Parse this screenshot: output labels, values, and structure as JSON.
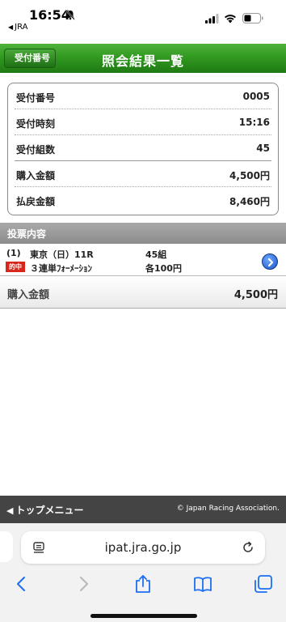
{
  "status_bar": {
    "time": "16:54",
    "back_app": "JRA"
  },
  "header": {
    "back_label": "受付番号",
    "title": "照会結果一覧"
  },
  "summary": {
    "rows": [
      {
        "label": "受付番号",
        "value": "0005"
      },
      {
        "label": "受付時刻",
        "value": "15:16"
      },
      {
        "label": "受付組数",
        "value": "45"
      },
      {
        "label": "購入金額",
        "value": "4,500円"
      },
      {
        "label": "払戻金額",
        "value": "8,460円"
      }
    ]
  },
  "section": {
    "title": "投票内容"
  },
  "bet": {
    "number": "(1)",
    "race": "東京（日）11R",
    "hit_badge": "的中",
    "type": "３連単ﾌｫｰﾒｰｼｮﾝ",
    "count": "45組",
    "unit": "各100円"
  },
  "total": {
    "label": "購入金額",
    "value": "4,500円"
  },
  "footer": {
    "top_menu": "トップメニュー",
    "copyright": "© Japan Racing Association."
  },
  "browser": {
    "url": "ipat.jra.go.jp"
  },
  "colors": {
    "header_green": "#2f961f",
    "hit_red": "#d8261c",
    "section_gray": "#9a9a9a",
    "footer_dark": "#444444",
    "link_blue": "#1c6ef2"
  }
}
